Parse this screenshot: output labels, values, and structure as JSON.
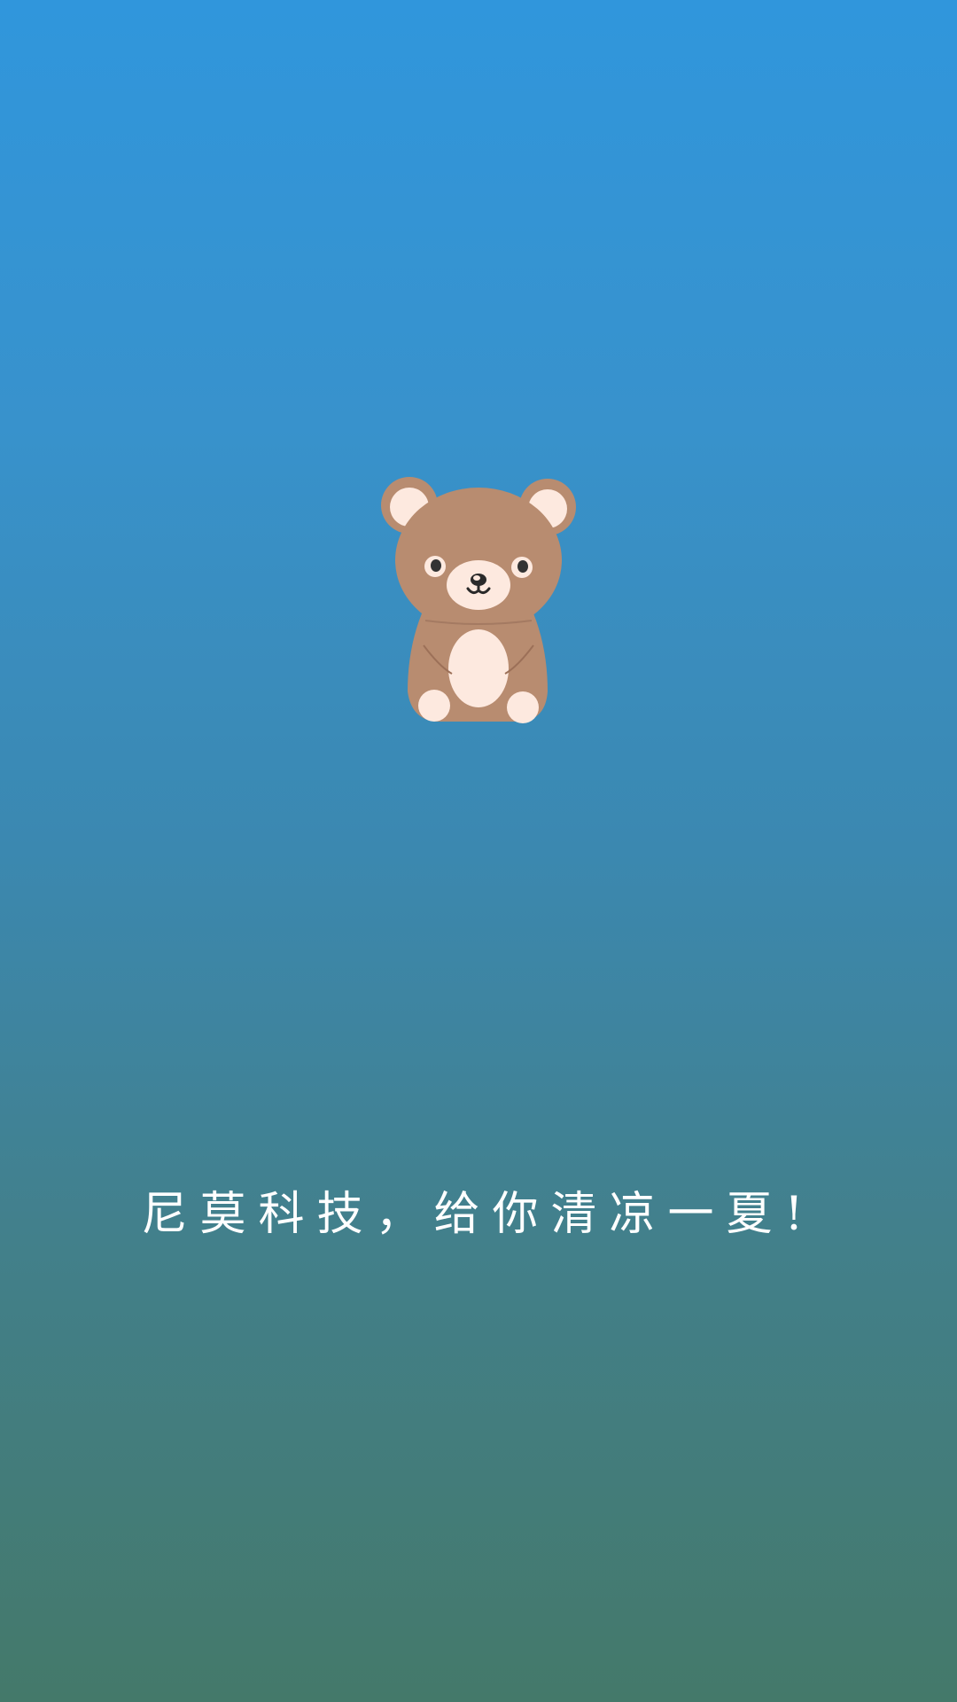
{
  "splash": {
    "slogan": "尼莫科技，给你清凉一夏!",
    "mascot_icon": "bear-mascot-icon"
  },
  "colors": {
    "background_top": "#3096dc",
    "background_bottom": "#44796a",
    "bear_fur": "#b88c70",
    "bear_light": "#fde9df",
    "text": "#ffffff"
  }
}
